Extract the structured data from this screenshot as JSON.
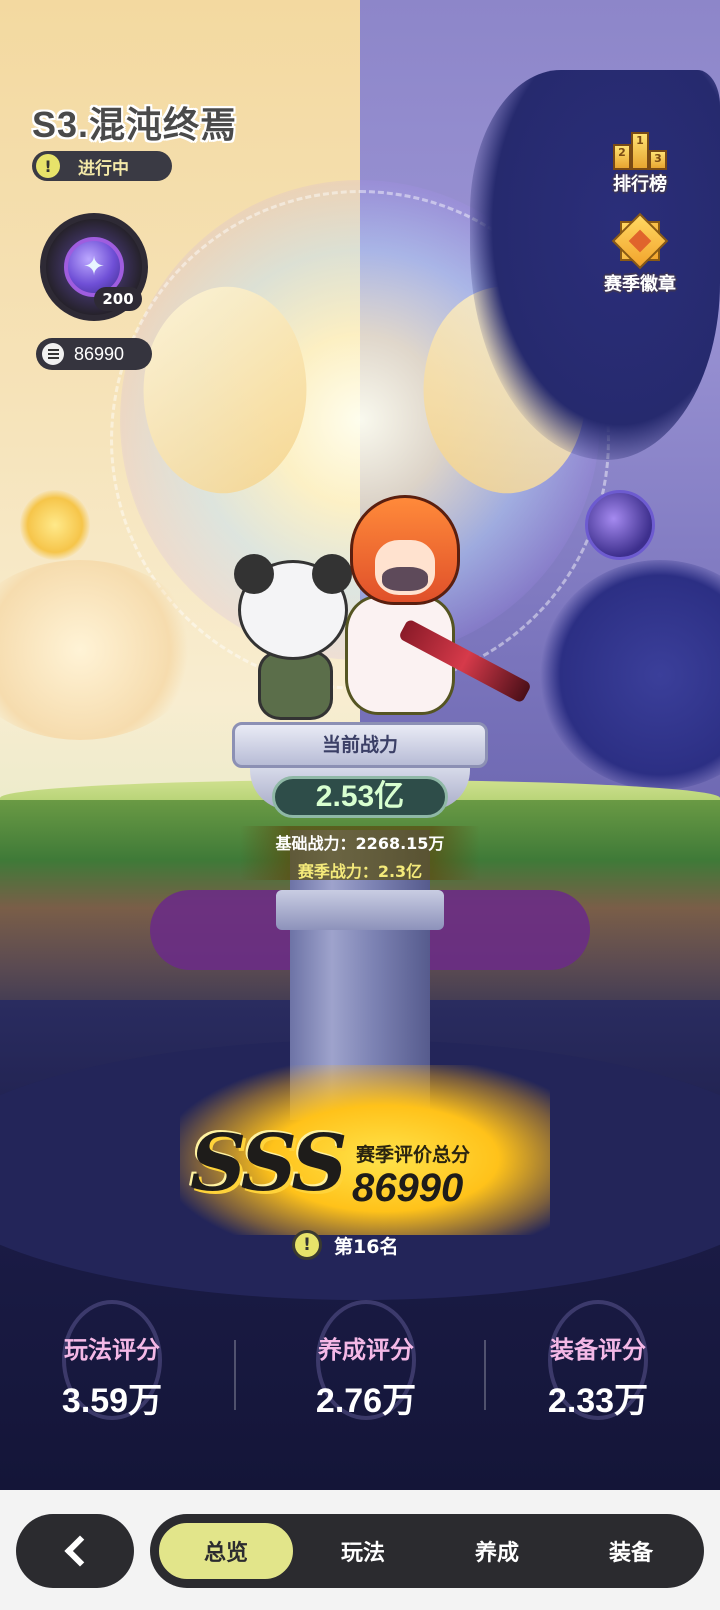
{
  "header": {
    "season_title": "S3.混沌终焉",
    "status": "进行中",
    "medal_count": "200",
    "points": "86990"
  },
  "side_buttons": {
    "ranking": "排行榜",
    "season_badge": "赛季徽章"
  },
  "power": {
    "label": "当前战力",
    "value": "2.53亿",
    "base": "基础战力：2268.15万",
    "season": "赛季战力：2.3亿"
  },
  "season_score": {
    "grade": "SSS",
    "label": "赛季评价总分",
    "value": "86990",
    "rank": "第16名"
  },
  "scores": [
    {
      "title": "玩法评分",
      "value": "3.59万"
    },
    {
      "title": "养成评分",
      "value": "2.76万"
    },
    {
      "title": "装备评分",
      "value": "2.33万"
    }
  ],
  "nav": {
    "tabs": [
      "总览",
      "玩法",
      "养成",
      "装备"
    ],
    "active_index": 0
  },
  "colors": {
    "accent": "#e2e58a",
    "nav_bg": "#2b2b2f",
    "score_title": "#f4b8e6"
  }
}
